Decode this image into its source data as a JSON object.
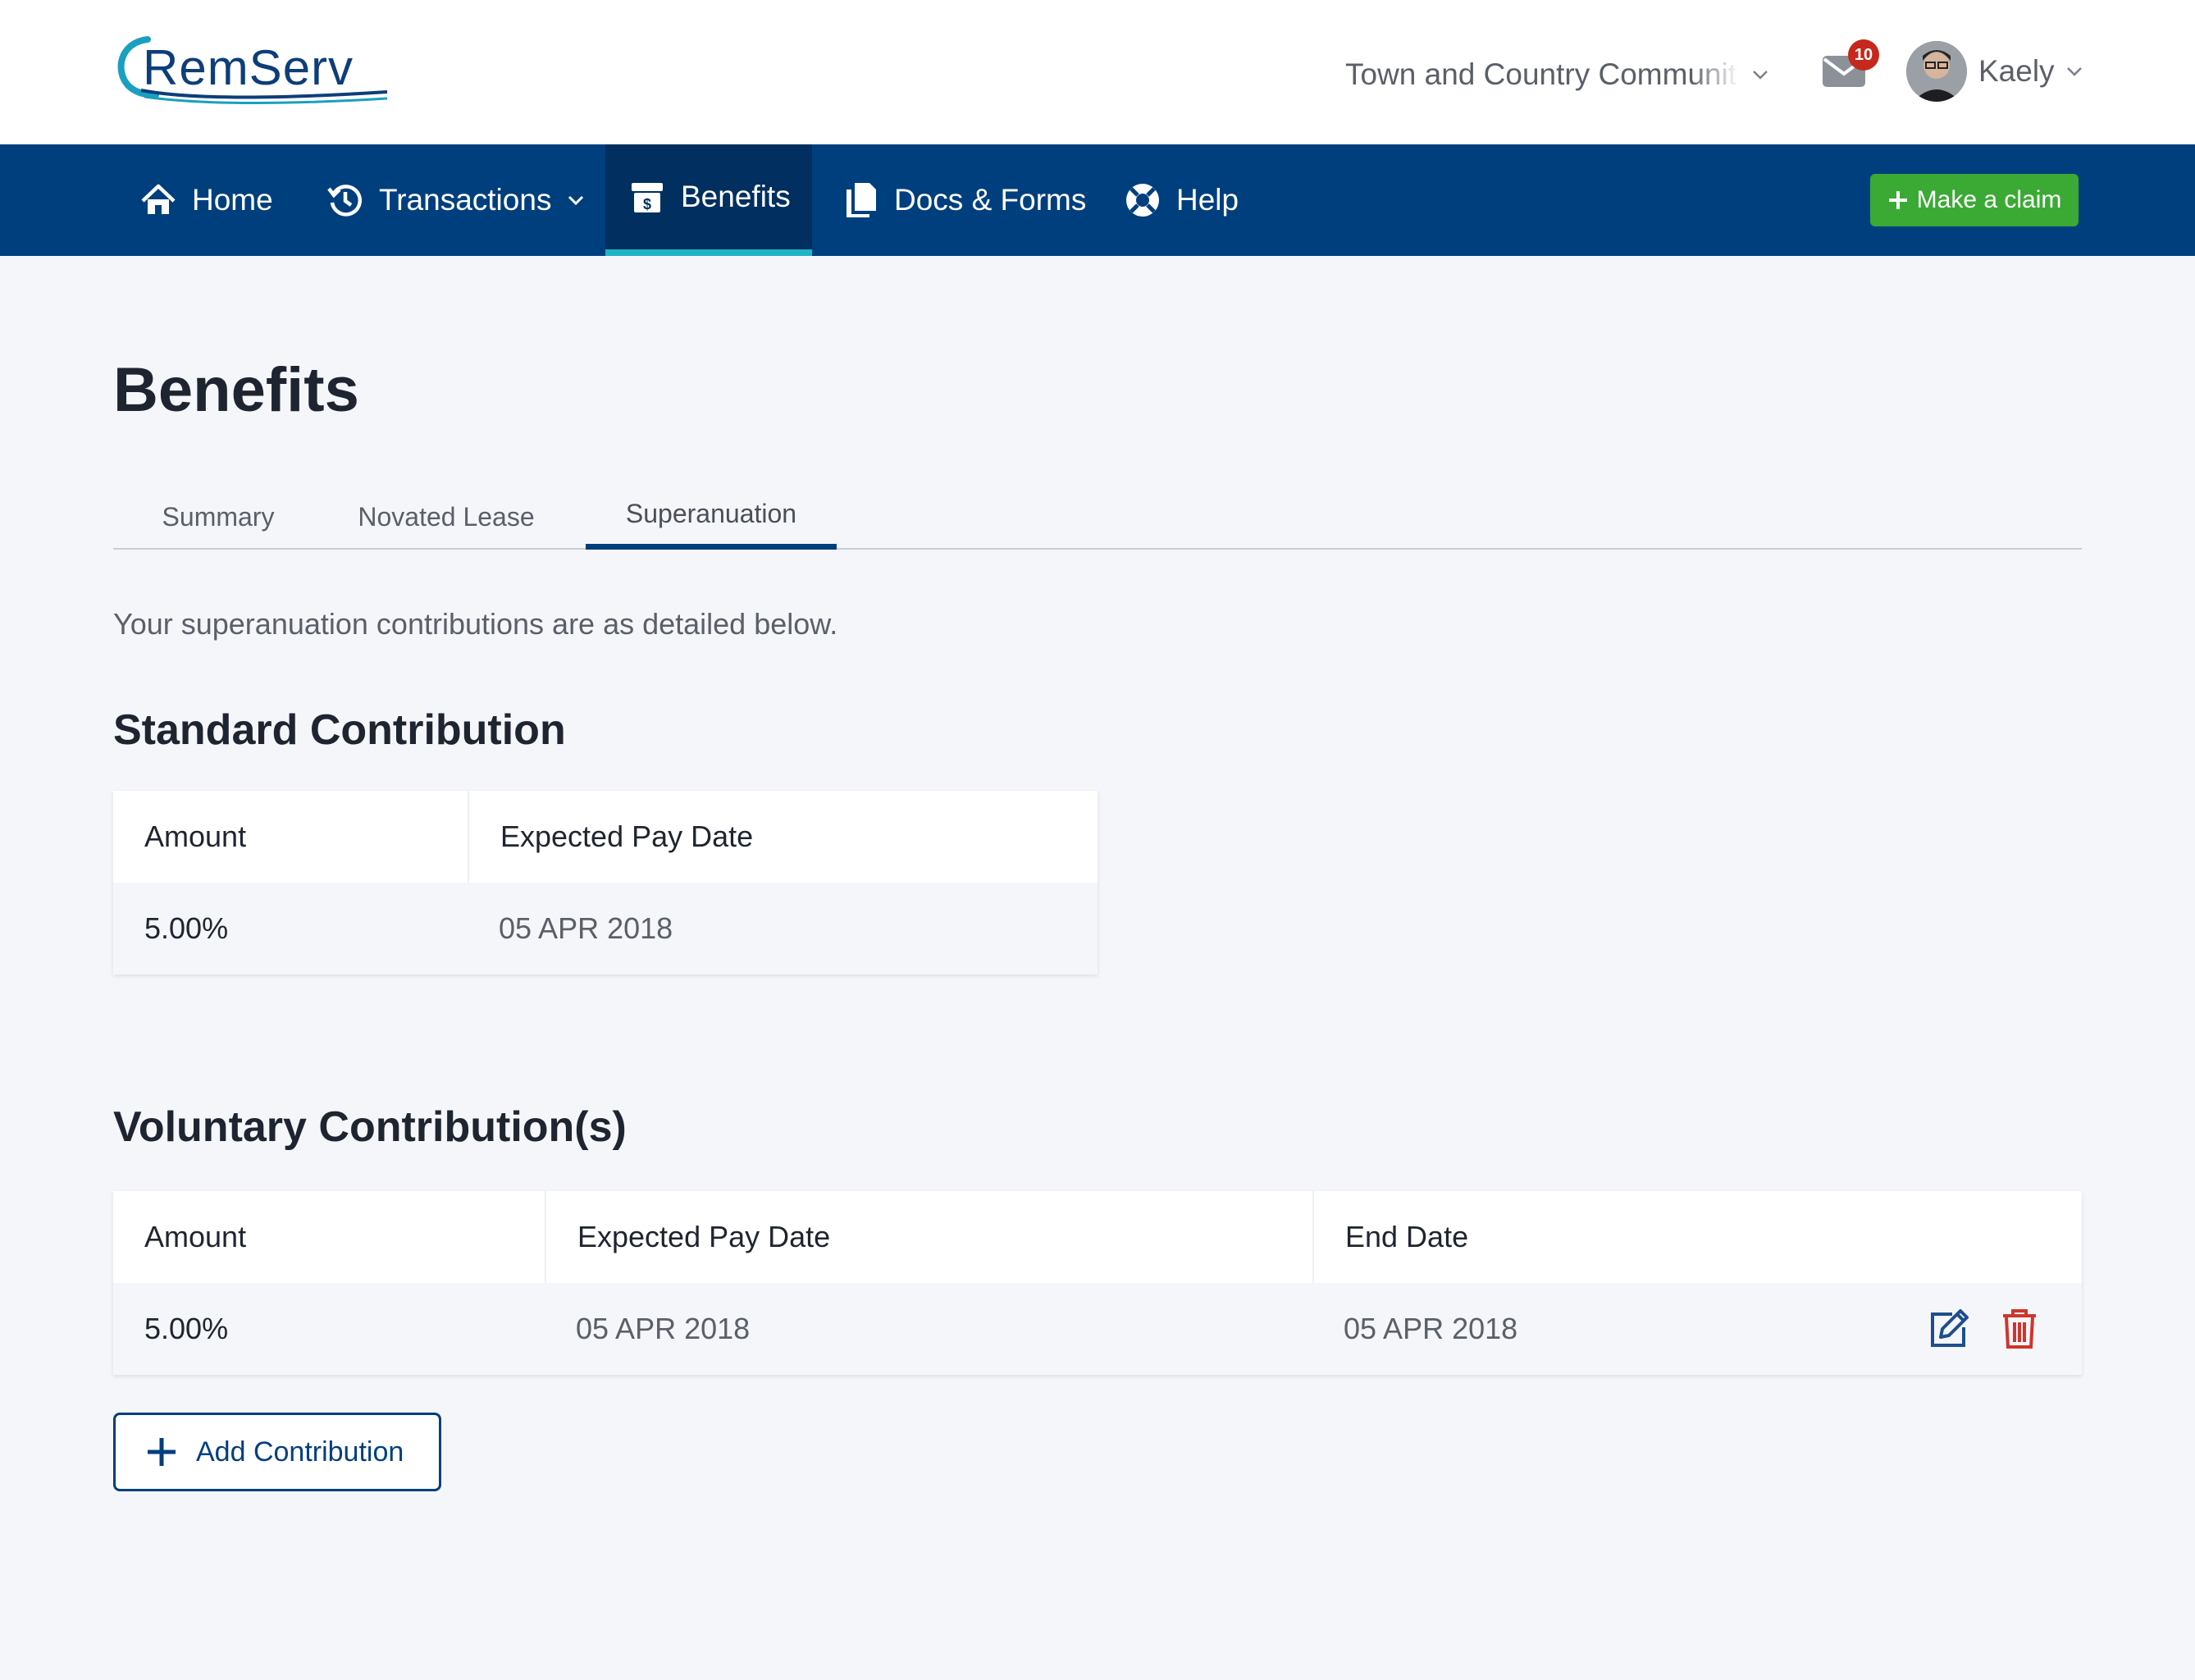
{
  "header": {
    "logo_text": "RemServ",
    "organisation": "Town and Country Community",
    "mail_count": "10",
    "user_name": "Kaely"
  },
  "nav": {
    "items": [
      {
        "label": "Home",
        "icon": "home-icon"
      },
      {
        "label": "Transactions",
        "icon": "history-icon"
      },
      {
        "label": "Benefits",
        "icon": "benefits-box-icon"
      },
      {
        "label": "Docs & Forms",
        "icon": "documents-icon"
      },
      {
        "label": "Help",
        "icon": "lifebuoy-icon"
      }
    ],
    "active": "Benefits",
    "claim_button": "Make a claim"
  },
  "page": {
    "title": "Benefits",
    "tabs": [
      "Summary",
      "Novated Lease",
      "Superanuation"
    ],
    "active_tab": "Superanuation",
    "intro": "Your superanuation contributions are as detailed below."
  },
  "standard": {
    "title": "Standard Contribution",
    "headers": [
      "Amount",
      "Expected Pay Date"
    ],
    "row": [
      "5.00%",
      "05 APR 2018"
    ]
  },
  "voluntary": {
    "title": "Voluntary Contribution(s)",
    "headers": [
      "Amount",
      "Expected Pay Date",
      "End Date"
    ],
    "row": [
      "5.00%",
      "05 APR 2018",
      "05 APR 2018"
    ]
  },
  "add_button": "Add Contribution",
  "colors": {
    "nav_bg": "#003f7d",
    "nav_active_bg": "#002f60",
    "nav_active_underline": "#1fb4c8",
    "claim_green": "#3aaa35",
    "badge_red": "#c5281c",
    "delete_red": "#d0352b",
    "page_bg": "#f4f6fa"
  }
}
